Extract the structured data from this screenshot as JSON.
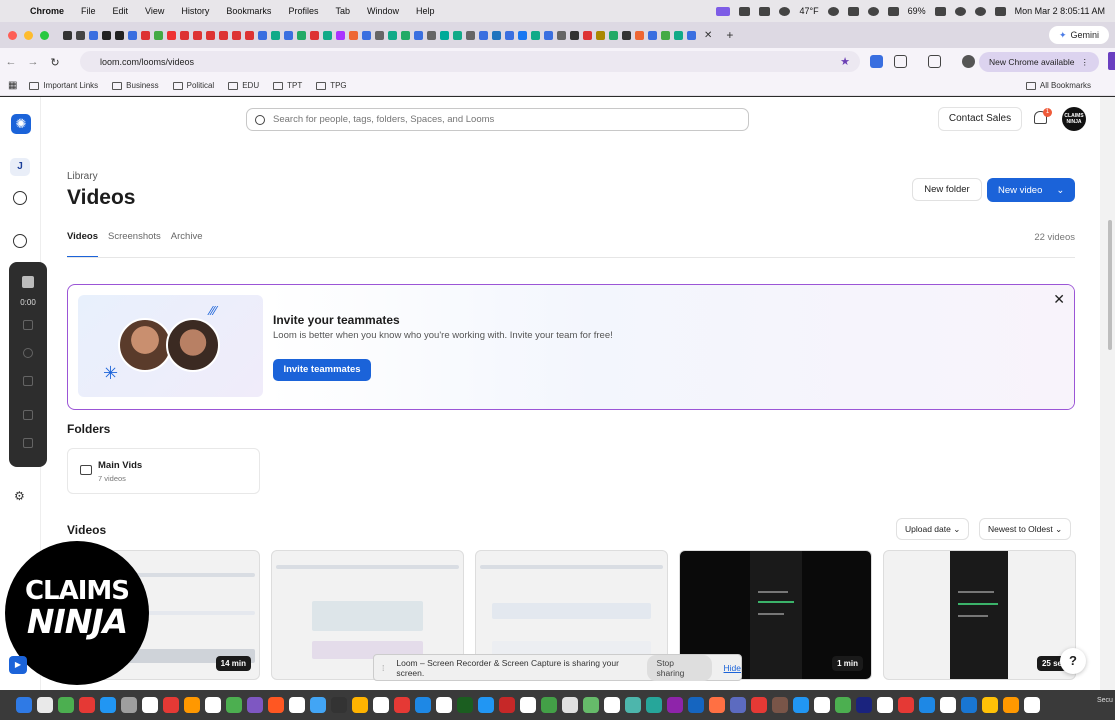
{
  "menubar": {
    "app": "Chrome",
    "items": [
      "File",
      "Edit",
      "View",
      "History",
      "Bookmarks",
      "Profiles",
      "Tab",
      "Window",
      "Help"
    ],
    "weather": "47°F",
    "battery": "69%",
    "datetime": "Mon Mar 2  8:05:11 AM"
  },
  "browser": {
    "gemini_label": "Gemini",
    "url": "loom.com/looms/videos",
    "new_chrome_label": "New Chrome available",
    "bookmarks": [
      "Important Links",
      "Business",
      "Political",
      "EDU",
      "TPT",
      "TPG"
    ],
    "all_bookmarks": "All Bookmarks"
  },
  "sidebar": {
    "workspace_initial": "J",
    "recorder_time": "0:00"
  },
  "header": {
    "search_placeholder": "Search for people, tags, folders, Spaces, and Looms",
    "contact_sales": "Contact Sales",
    "notification_count": "1",
    "avatar_text": "CLAIMS NINJA"
  },
  "library": {
    "breadcrumb": "Library",
    "title": "Videos",
    "new_folder": "New folder",
    "new_video": "New video",
    "tabs": [
      "Videos",
      "Screenshots",
      "Archive"
    ],
    "video_count": "22 videos"
  },
  "invite": {
    "title": "Invite your teammates",
    "text": "Loom is better when you know who you're working with. Invite your team for free!",
    "button": "Invite teammates"
  },
  "folders": {
    "heading": "Folders",
    "items": [
      {
        "name": "Main Vids",
        "count": "7 videos"
      }
    ]
  },
  "videos": {
    "heading": "Videos",
    "sort_field": "Upload date",
    "sort_order": "Newest to Oldest",
    "items": [
      {
        "duration": "14 min"
      },
      {
        "duration": ""
      },
      {
        "duration": ""
      },
      {
        "duration": "1 min"
      },
      {
        "duration": "25 se"
      }
    ]
  },
  "share_bar": {
    "text": "Loom – Screen Recorder & Screen Capture is sharing your screen.",
    "stop": "Stop sharing",
    "hide": "Hide"
  },
  "overlay": {
    "line1": "CLAIMS",
    "line2": "NINJA"
  },
  "help_label": "?",
  "dock_label": "Secu"
}
